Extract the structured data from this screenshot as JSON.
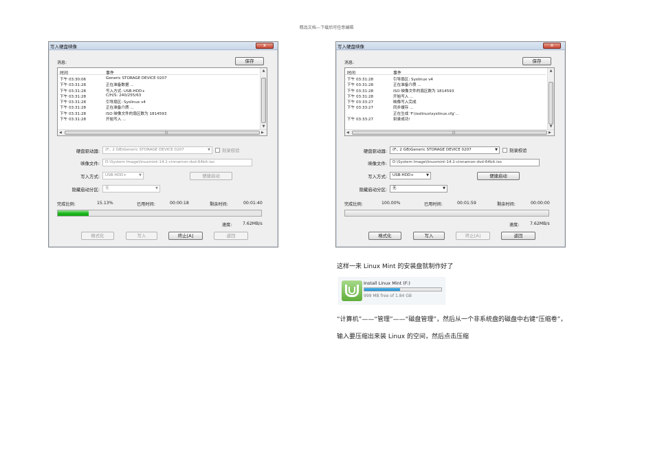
{
  "watermark": "精品文档---下载后可任意编辑",
  "dialogs": [
    {
      "title": "写入硬盘映像",
      "close_glyph": "x",
      "messages_label": "消息:",
      "save_label": "保存",
      "log_headers": [
        "时间",
        "事件"
      ],
      "log_rows": [
        [
          "下午 03:30:06",
          "Generic STORAGE DEVICE  0207"
        ],
        [
          "下午 03:31:28",
          "正在准备数据 ..."
        ],
        [
          "下午 03:31:28",
          "写入方式: USB-HDD+"
        ],
        [
          "下午 03:31:28",
          "C/H/S: 240/255/63"
        ],
        [
          "下午 03:31:28",
          "引导扇区: Syslinux v4"
        ],
        [
          "下午 03:31:28",
          "正在准备介质 ..."
        ],
        [
          "下午 03:31:28",
          "ISO 映像文件的扇区数为 1814593"
        ],
        [
          "下午 03:31:28",
          "开始写入 ..."
        ]
      ],
      "drive_label": "硬盘驱动器:",
      "drive_value": "(F:, 2 GB)Generic STORAGE DEVICE  0207",
      "verify_label": "刻录校验",
      "image_label": "映像文件:",
      "image_value": "D:\\System Image\\linuxmint-14.1-cinnamon-dvd-64bit.iso",
      "write_mode_label": "写入方式:",
      "write_mode_value": "USB-HDD+",
      "convenient_boot_label": "便捷启动",
      "hidden_partition_label": "隐藏启动分区:",
      "hidden_partition_value": "无",
      "progress_label": "完成比例:",
      "progress_value": "15.13%",
      "progress_fraction": 0.1513,
      "elapsed_label": "已用时间:",
      "elapsed_value": "00:00:18",
      "remaining_label": "剩余时间:",
      "remaining_value": "00:01:40",
      "speed_label": "速度:",
      "speed_value": "7.62MB/s",
      "buttons": [
        "格式化",
        "写入",
        "终止[A]",
        "返回"
      ]
    },
    {
      "title": "写入硬盘映像",
      "close_glyph": "x",
      "messages_label": "消息:",
      "save_label": "保存",
      "log_headers": [
        "时间",
        "事件"
      ],
      "log_rows": [
        [
          "下午 03:31:28",
          "引导扇区: Syslinux v4"
        ],
        [
          "下午 03:31:28",
          "正在准备介质 ..."
        ],
        [
          "下午 03:31:28",
          "ISO 映像文件的扇区数为 1814593"
        ],
        [
          "下午 03:31:28",
          "开始写入 ..."
        ],
        [
          "下午 03:33:27",
          "映像写入完成"
        ],
        [
          "下午 03:33:27",
          "同步缓存 ..."
        ],
        [
          "",
          "正在生成 'F:\\isolinux\\syslinux.cfg'..."
        ],
        [
          "下午 03:33:27",
          "刻录成功!"
        ]
      ],
      "drive_label": "硬盘驱动器:",
      "drive_value": "(F:, 2 GB)Generic STORAGE DEVICE  0207",
      "verify_label": "刻录校验",
      "image_label": "映像文件:",
      "image_value": "D:\\System Image\\linuxmint-14.1-cinnamon-dvd-64bit.iso",
      "write_mode_label": "写入方式:",
      "write_mode_value": "USB-HDD+",
      "convenient_boot_label": "便捷启动",
      "hidden_partition_label": "隐藏启动分区:",
      "hidden_partition_value": "无",
      "progress_label": "完成比例:",
      "progress_value": "100.00%",
      "progress_fraction": 1.0,
      "elapsed_label": "已用时间:",
      "elapsed_value": "00:01:59",
      "remaining_label": "剩余时间:",
      "remaining_value": "00:00:00",
      "speed_label": "速度:",
      "speed_value": "7.62MB/s",
      "buttons": [
        "格式化",
        "写入",
        "终止[A]",
        "返回"
      ]
    }
  ],
  "text": {
    "p1": "这样一来 Linux Mint 的安装盘就制作好了",
    "p2": "“计算机”——“管理”——“磁盘管理”，然后从一个非系统盘的磁盘中右键“压缩卷”，",
    "p3": "输入要压缩出来装 Linux 的空间，然后点击压缩"
  },
  "drive_tile": {
    "name": "Install Linux Mint (F:)",
    "free": "999 MB free of 1.84 GB",
    "used_fraction": 0.46,
    "icon": "linux-mint-logo-icon"
  }
}
